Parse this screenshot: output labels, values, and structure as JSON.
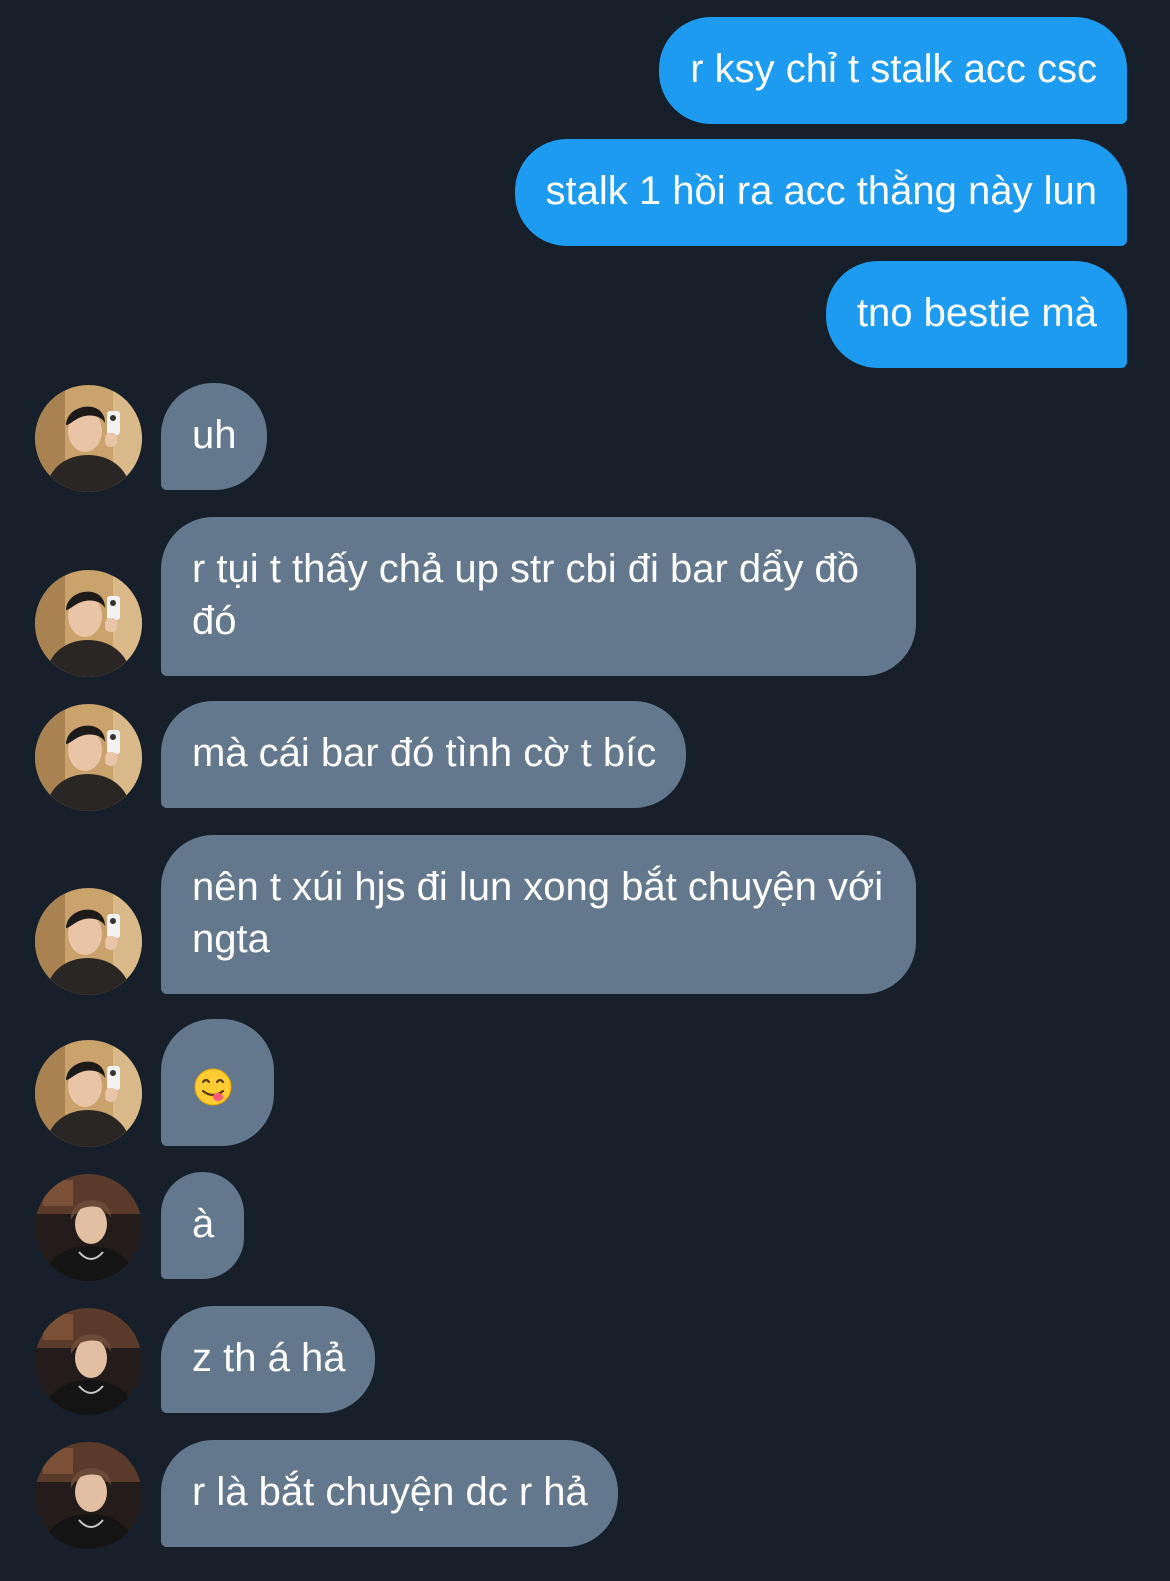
{
  "conversation": {
    "colors": {
      "background": "#17202a",
      "sent_bubble": "#1d9bf0",
      "received_bubble": "#63788c",
      "text": "#ffffff"
    },
    "messages": [
      {
        "direction": "sent",
        "text": "r ksy chỉ t stalk acc csc"
      },
      {
        "direction": "sent",
        "text": "stalk 1 hồi ra acc thằng này lun"
      },
      {
        "direction": "sent",
        "text": "tno bestie mà"
      },
      {
        "direction": "received",
        "sender_avatar": "avatar-user-a",
        "text": "uh"
      },
      {
        "direction": "received",
        "sender_avatar": "avatar-user-a",
        "text": "r tụi t thấy chả up str cbi đi bar dẩy đồ đó"
      },
      {
        "direction": "received",
        "sender_avatar": "avatar-user-a",
        "text": "mà cái bar đó tình cờ t bíc"
      },
      {
        "direction": "received",
        "sender_avatar": "avatar-user-a",
        "text": "nên t xúi hjs đi lun xong bắt chuyện với ngta"
      },
      {
        "direction": "received",
        "sender_avatar": "avatar-user-a",
        "emoji": "face-savoring-food-emoji"
      },
      {
        "direction": "received",
        "sender_avatar": "avatar-user-b",
        "text": "à"
      },
      {
        "direction": "received",
        "sender_avatar": "avatar-user-b",
        "text": "z th á hả"
      },
      {
        "direction": "received",
        "sender_avatar": "avatar-user-b",
        "text": "r là bắt chuyện dc r hả"
      }
    ]
  }
}
